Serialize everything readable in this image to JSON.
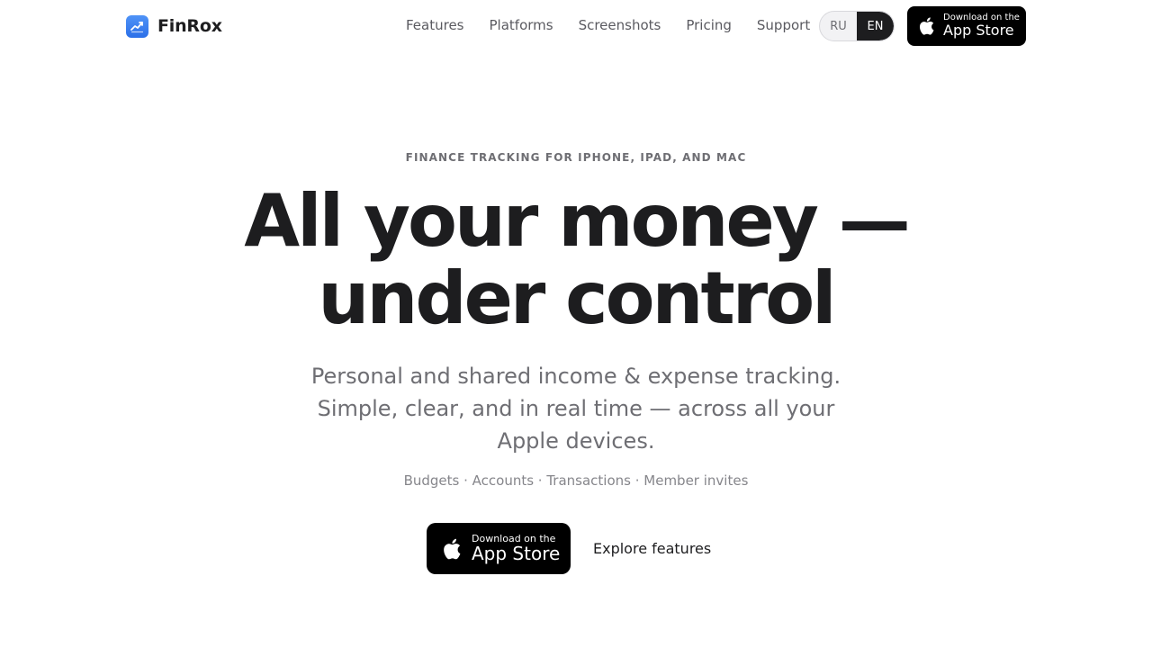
{
  "brand": {
    "name": "FinRox",
    "icon": "chart-trend-icon",
    "icon_color": "#3b82f6"
  },
  "nav": {
    "items": [
      {
        "label": "Features"
      },
      {
        "label": "Platforms"
      },
      {
        "label": "Screenshots"
      },
      {
        "label": "Pricing"
      },
      {
        "label": "Support"
      }
    ]
  },
  "lang": {
    "options": [
      "RU",
      "EN"
    ],
    "selected": "EN"
  },
  "appstore_badge": {
    "small": "Download on the",
    "big": "App Store",
    "icon": "apple-icon"
  },
  "hero": {
    "eyebrow": "FINANCE TRACKING FOR IPHONE, IPAD, AND MAC",
    "headline_line1": "All your money —",
    "headline_line2": "under control",
    "subtitle": "Personal and shared income & expense tracking. Simple, clear, and in real time — across all your Apple devices.",
    "tags": "Budgets · Accounts · Transactions · Member invites",
    "explore_label": "Explore features"
  }
}
